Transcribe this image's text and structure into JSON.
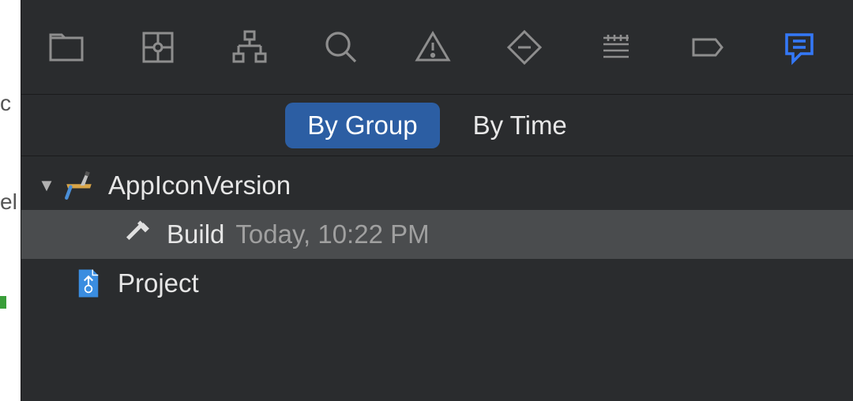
{
  "navigatorTabs": {
    "project": "Project Navigator",
    "sourceControl": "Source Control Navigator",
    "symbols": "Symbol Navigator",
    "find": "Find Navigator",
    "issues": "Issue Navigator",
    "tests": "Test Navigator",
    "debug": "Debug Navigator",
    "breakpoints": "Breakpoint Navigator",
    "reports": "Report Navigator"
  },
  "filterTabs": {
    "byGroup": "By Group",
    "byTime": "By Time",
    "selected": "byGroup"
  },
  "tree": {
    "root": {
      "label": "AppIconVersion",
      "expanded": true
    },
    "build": {
      "label": "Build",
      "time": "Today, 10:22 PM"
    },
    "project": {
      "label": "Project"
    }
  },
  "bgFragments": {
    "f1": "c",
    "f2": "el"
  }
}
